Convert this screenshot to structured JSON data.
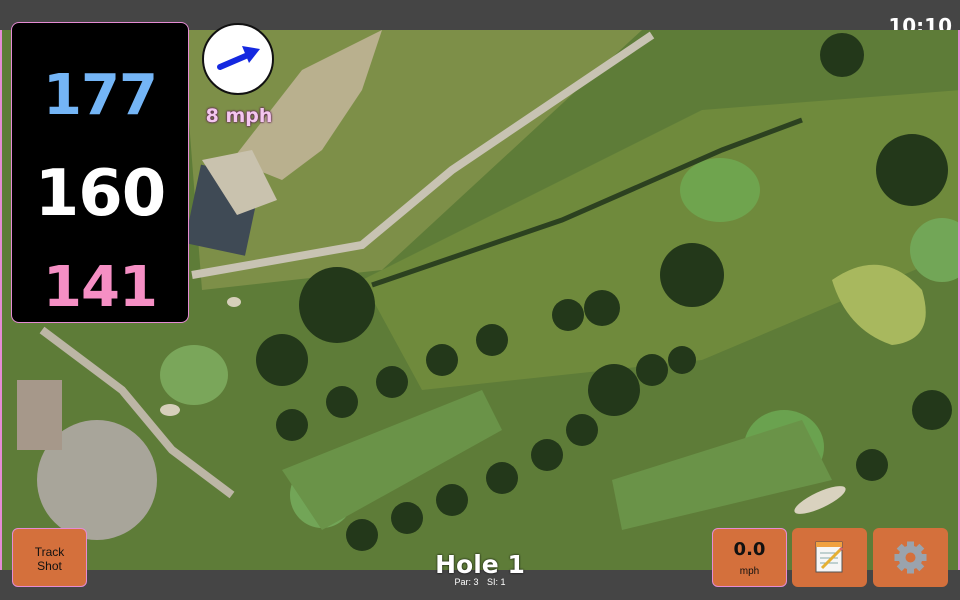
{
  "status_bar": {
    "time": "10:10"
  },
  "distances": {
    "back": "177",
    "middle": "160",
    "front": "141"
  },
  "wind": {
    "speed": "8 mph",
    "icon": "wind-arrow-icon"
  },
  "hole": {
    "title": "Hole 1",
    "par": "Par: 3",
    "si": "SI: 1"
  },
  "buttons": {
    "track_line1": "Track",
    "track_line2": "Shot",
    "speed_value": "0.0",
    "speed_unit": "mph",
    "notes_icon": "notepad-icon",
    "settings_icon": "gear-icon"
  },
  "colors": {
    "back_distance": "#74b5f6",
    "middle_distance": "#ffffff",
    "front_distance": "#f58fc4",
    "button": "#d4703c",
    "accent_border": "#e58bd4"
  }
}
